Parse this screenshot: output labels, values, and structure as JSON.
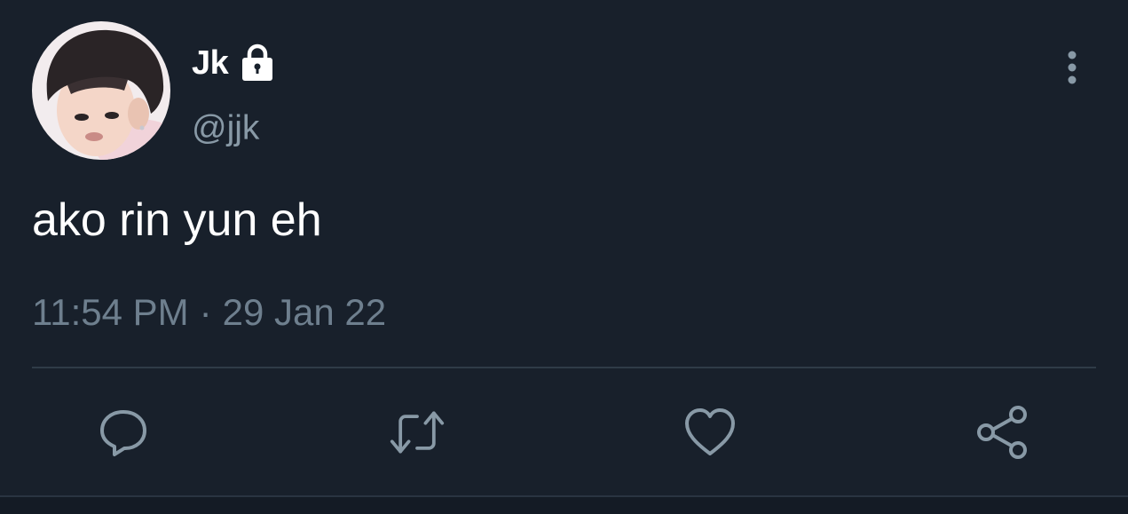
{
  "tweet": {
    "author": {
      "display_name": "Jk",
      "handle": "@jjk",
      "protected_icon": "lock-icon",
      "avatar": "profile-photo"
    },
    "text": "ako rin yun eh",
    "time": "11:54 PM",
    "separator": "·",
    "date": "29 Jan 22",
    "menu_icon": "more-vertical-icon"
  },
  "actions": [
    {
      "name": "reply",
      "icon": "reply-icon"
    },
    {
      "name": "retweet",
      "icon": "retweet-icon"
    },
    {
      "name": "like",
      "icon": "heart-icon"
    },
    {
      "name": "share",
      "icon": "share-icon"
    }
  ],
  "colors": {
    "background": "#18202b",
    "primary_text": "#ffffff",
    "secondary_text": "#8899a6",
    "divider": "#2f3b47"
  }
}
